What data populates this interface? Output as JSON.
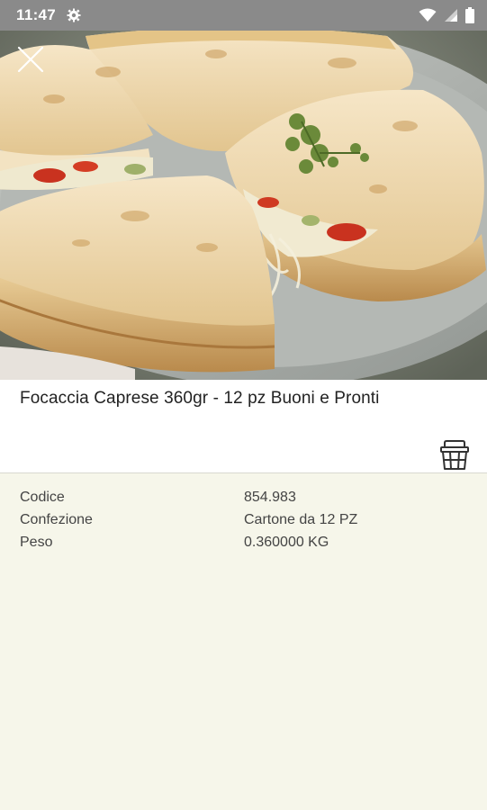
{
  "status_bar": {
    "time": "11:47"
  },
  "product": {
    "title": "Focaccia Caprese 360gr - 12 pz Buoni e Pronti",
    "details": [
      {
        "label": "Codice",
        "value": "854.983"
      },
      {
        "label": "Confezione",
        "value": "Cartone da 12 PZ"
      },
      {
        "label": "Peso",
        "value": "0.360000 KG"
      }
    ]
  },
  "icons": {
    "close": "close-icon",
    "cart": "basket-icon",
    "settings": "gear-icon",
    "wifi": "wifi-icon",
    "signal": "signal-icon",
    "battery": "battery-icon"
  },
  "colors": {
    "page_background": "#f6f6ea",
    "status_bar": "#8a8a8a"
  }
}
